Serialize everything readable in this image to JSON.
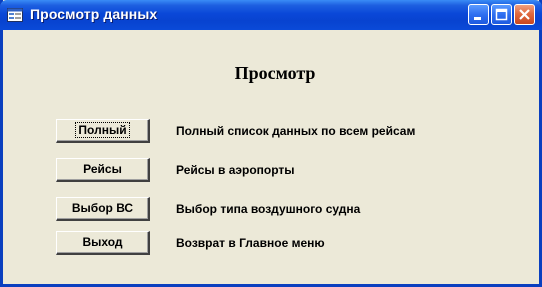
{
  "window": {
    "title": "Просмотр данных",
    "icon": "form-icon",
    "controls": [
      "minimize-icon",
      "maximize-icon",
      "close-icon"
    ],
    "colors": {
      "titlebar": "#0a48d8",
      "close_button": "#e06a40",
      "face": "#ece9d8"
    }
  },
  "form": {
    "heading": "Просмотр",
    "rows": [
      {
        "button": "Полный",
        "description": "Полный список данных по всем рейсам"
      },
      {
        "button": "Рейсы",
        "description": "Рейсы в аэропорты"
      },
      {
        "button": "Выбор ВС",
        "description": "Выбор типа воздушного судна"
      },
      {
        "button": "Выход",
        "description": "Возврат в Главное меню"
      }
    ]
  }
}
